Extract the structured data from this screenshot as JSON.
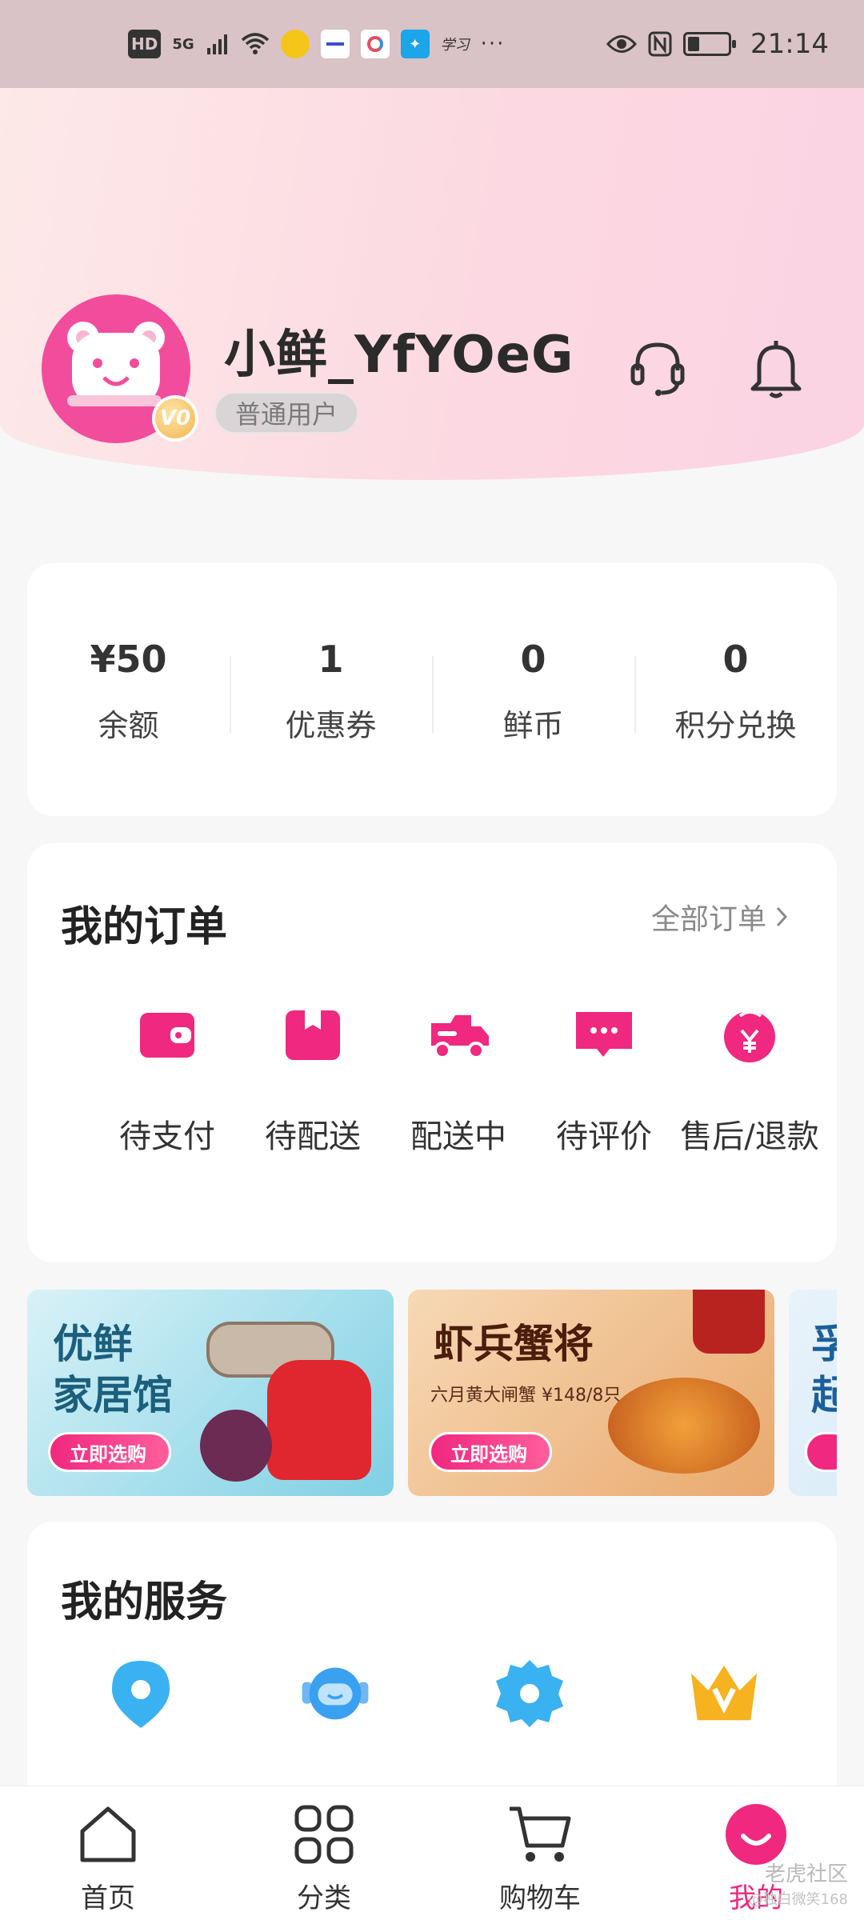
{
  "status_bar": {
    "network": "HD",
    "signal": "5G",
    "time": "21:14",
    "extra_app": "学习"
  },
  "profile": {
    "username": "小鲜_YfYOeG",
    "level": "普通用户",
    "vip_badge": "V0",
    "customer_service_icon": "headset-icon",
    "notification_icon": "bell-icon"
  },
  "stats": [
    {
      "value": "¥50",
      "label": "余额"
    },
    {
      "value": "1",
      "label": "优惠券"
    },
    {
      "value": "0",
      "label": "鲜币"
    },
    {
      "value": "0",
      "label": "积分兑换"
    }
  ],
  "orders": {
    "title": "我的订单",
    "all_link": "全部订单",
    "items": [
      {
        "label": "待支付",
        "icon": "wallet-icon"
      },
      {
        "label": "待配送",
        "icon": "package-icon"
      },
      {
        "label": "配送中",
        "icon": "truck-icon"
      },
      {
        "label": "待评价",
        "icon": "comment-icon"
      },
      {
        "label": "售后/退款",
        "icon": "refund-icon"
      }
    ]
  },
  "banners": [
    {
      "title_line1": "优鲜",
      "title_line2": "家居馆",
      "button": "立即选购"
    },
    {
      "title_line1": "虾兵蟹将",
      "subtitle": "六月黄大闸蟹 ¥148/8只",
      "button": "立即选购"
    },
    {
      "title_line1": "孚",
      "title_line2": "起"
    }
  ],
  "services": {
    "title": "我的服务",
    "items": [
      {
        "icon": "location-pin-icon"
      },
      {
        "icon": "support-robot-icon"
      },
      {
        "icon": "settings-gear-icon"
      },
      {
        "icon": "vip-crown-icon"
      }
    ]
  },
  "bottom_nav": [
    {
      "label": "首页",
      "icon": "home-icon"
    },
    {
      "label": "分类",
      "icon": "category-icon"
    },
    {
      "label": "购物车",
      "icon": "cart-icon"
    },
    {
      "label": "我的",
      "icon": "profile-icon",
      "active": true
    }
  ],
  "watermark": "老虎社区",
  "watermark_sub": "@独白微笑168",
  "colors": {
    "accent": "#f0287f",
    "header_gradient_start": "#fde9e8",
    "header_gradient_end": "#fbd3e3"
  }
}
